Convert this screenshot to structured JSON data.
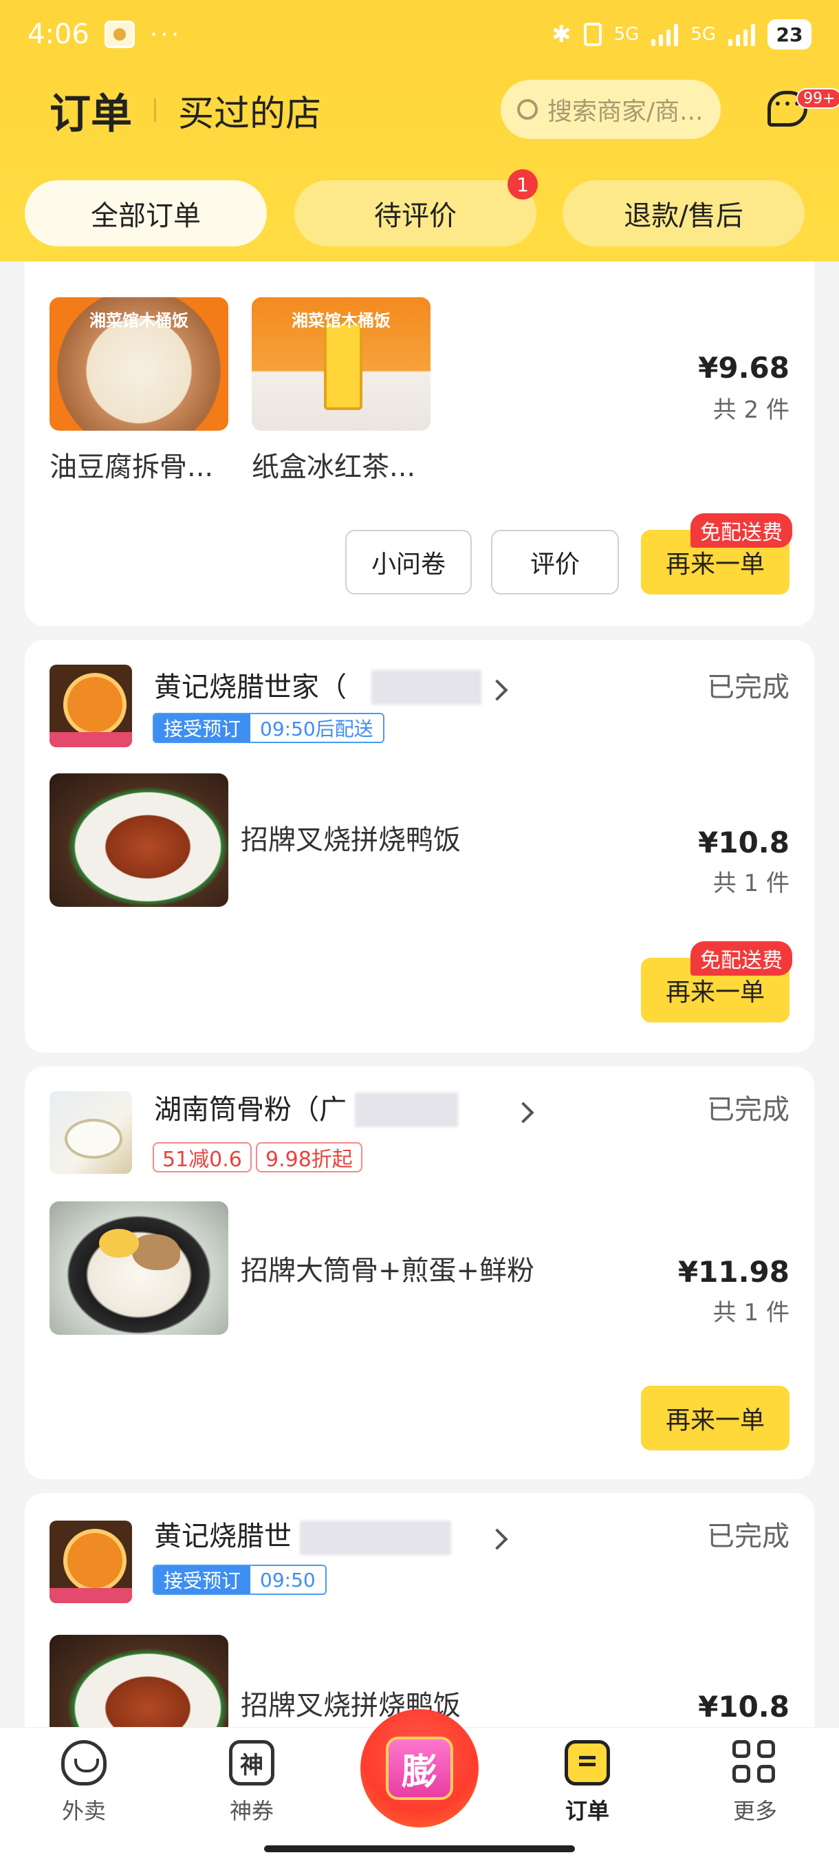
{
  "status_bar": {
    "time": "4:06",
    "dots": "···",
    "net1": "5G",
    "net2": "5G",
    "battery": "23"
  },
  "header": {
    "title": "订单",
    "subtitle": "买过的店",
    "search_placeholder": "搜索商家/商...",
    "msg_badge": "99+"
  },
  "tabs": [
    {
      "label": "全部订单",
      "active": true
    },
    {
      "label": "待评价",
      "badge": "1"
    },
    {
      "label": "退款/售后"
    }
  ],
  "orders": [
    {
      "items": [
        {
          "name": "油豆腐拆骨...",
          "image": "wood-bucket-rice",
          "banner": "湘菜馆木桶饭"
        },
        {
          "name": "纸盒冰红茶...",
          "image": "ice-tea-carton",
          "banner": "湘菜馆木桶饭"
        }
      ],
      "price": "¥9.68",
      "count": "共 2 件",
      "buttons": {
        "survey": "小问卷",
        "review": "评价",
        "reorder": "再来一单"
      },
      "free_delivery": "免配送费"
    },
    {
      "shop": "黄记烧腊世家（",
      "status": "已完成",
      "tag_a": "接受预订",
      "tag_b": "09:50后配送",
      "item": "招牌叉烧拼烧鸭饭",
      "price": "¥10.8",
      "count": "共 1 件",
      "reorder": "再来一单",
      "free_delivery": "免配送费"
    },
    {
      "shop": "湖南筒骨粉（广",
      "status": "已完成",
      "promo1": "51减0.6",
      "promo2": "9.98折起",
      "item": "招牌大筒骨+煎蛋+鲜粉",
      "price": "¥11.98",
      "count": "共 1 件",
      "reorder": "再来一单"
    },
    {
      "shop": "黄记烧腊世",
      "status": "已完成",
      "tag_a": "接受预订",
      "tag_b": "09:50",
      "item": "招牌叉烧拼烧鸭饭",
      "price": "¥10.8"
    }
  ],
  "tabbar": {
    "waimai": "外卖",
    "shenquan": "神券",
    "shen_glyph": "神",
    "center_glyph": "膨",
    "orders": "订单",
    "more": "更多"
  },
  "colors": {
    "brand_yellow": "#ffd43b",
    "button_yellow": "#ffd83a",
    "badge_red": "#f23a3a",
    "tag_blue": "#3f8ef2"
  }
}
